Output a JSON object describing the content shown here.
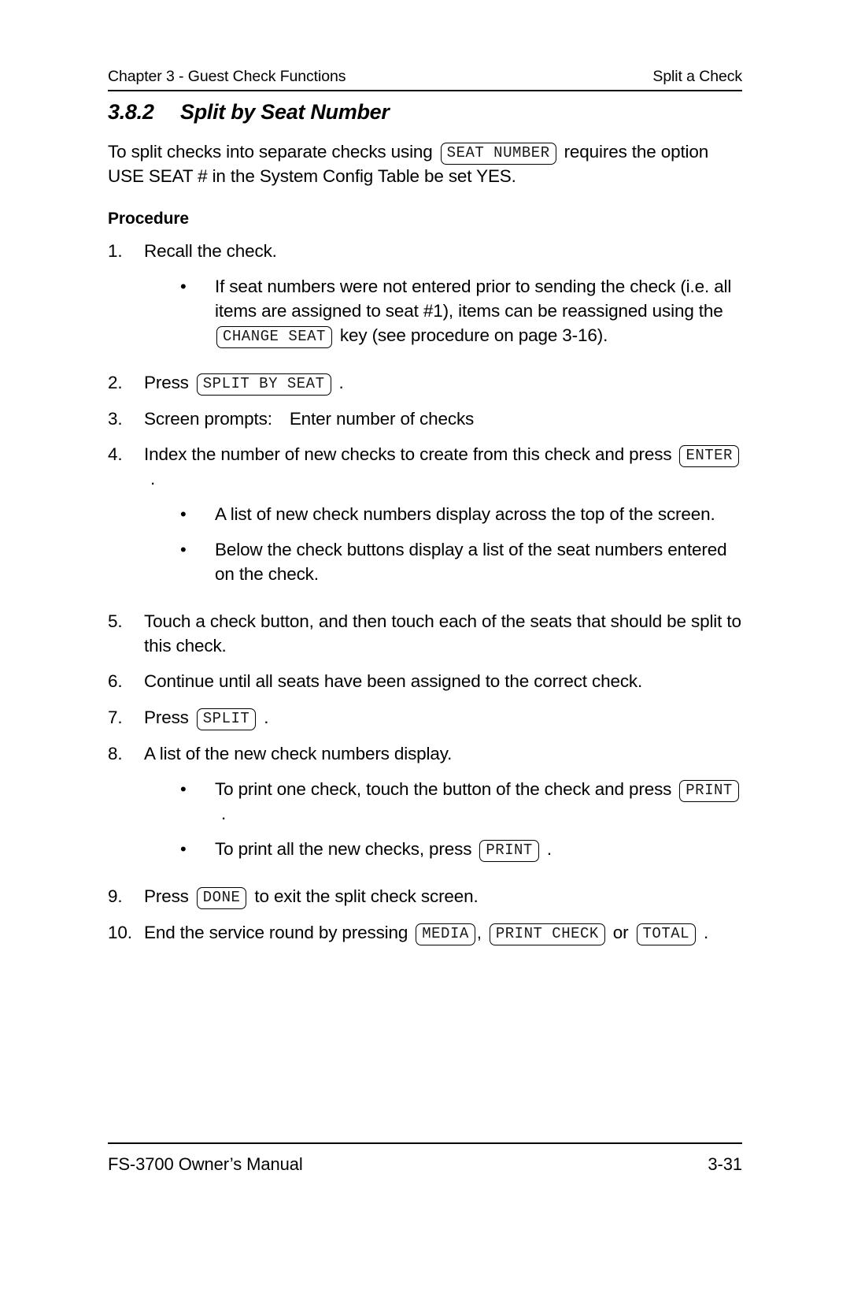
{
  "header": {
    "left": "Chapter 3 - Guest Check Functions",
    "right": "Split a Check"
  },
  "section": {
    "number": "3.8.2",
    "title": "Split by Seat Number"
  },
  "intro": {
    "before_key": "To split checks into separate checks using",
    "key": "SEAT NUMBER",
    "after_key": "requires the option USE SEAT # in the System Config Table be set YES."
  },
  "procedure_heading": "Procedure",
  "steps": [
    {
      "marker": "1.",
      "text": "Recall the check.",
      "bullets": [
        {
          "dot": "•",
          "before_key": "If seat numbers were not entered prior to sending the check (i.e. all items are assigned to seat #1), items can be reassigned using the",
          "key": "CHANGE SEAT",
          "after_key": "key (see procedure on page 3-16)."
        }
      ]
    },
    {
      "marker": "2.",
      "before_key": "Press",
      "key": "SPLIT BY SEAT",
      "after_key": "."
    },
    {
      "marker": "3.",
      "text_a": "Screen prompts:",
      "text_b": "Enter number of checks"
    },
    {
      "marker": "4.",
      "before_key": "Index the number of new checks to create from this check and press",
      "key": "ENTER",
      "after_key": ".",
      "bullets": [
        {
          "dot": "•",
          "text": "A list of new check numbers display across the top of the screen."
        },
        {
          "dot": "•",
          "text": "Below the check buttons display a list of the seat numbers entered on the check."
        }
      ]
    },
    {
      "marker": "5.",
      "text": "Touch a check button, and then touch each of the seats that should be split to this check."
    },
    {
      "marker": "6.",
      "text": "Continue until all seats have been assigned to the correct check."
    },
    {
      "marker": "7.",
      "before_key": "Press",
      "key": "SPLIT",
      "after_key": "."
    },
    {
      "marker": "8.",
      "text": "A list of the new check numbers display.",
      "bullets": [
        {
          "dot": "•",
          "before_key": "To print one check, touch the button of the check and press",
          "key": "PRINT",
          "after_key": "."
        },
        {
          "dot": "•",
          "before_key": "To print all the new checks, press",
          "key": "PRINT",
          "after_key": "."
        }
      ]
    },
    {
      "marker": "9.",
      "before_key": "Press",
      "key": "DONE",
      "after_key": "to exit the split check screen."
    },
    {
      "marker": "10.",
      "before_key": "End the service round by pressing",
      "key1": "MEDIA",
      "mid1": ",",
      "key2": "PRINT CHECK",
      "mid2": "or",
      "key3": "TOTAL",
      "after_key": "."
    }
  ],
  "footer": {
    "left": "FS-3700 Owner’s Manual",
    "right": "3-31"
  }
}
